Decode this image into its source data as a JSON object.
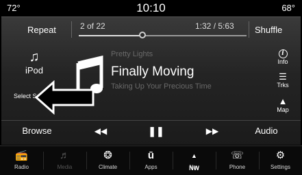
{
  "status": {
    "temp_left": "72°",
    "time": "10:10",
    "temp_right": "68°"
  },
  "controls": {
    "repeat": "Repeat",
    "track_count": "2 of 22",
    "time_readout": "1:32 / 5:63",
    "shuffle": "Shuffle",
    "progress": 0.38
  },
  "source": {
    "label": "iPod",
    "select_source": "Select Source",
    "icon": "music-note-icon"
  },
  "track": {
    "artist": "Pretty Lights",
    "title": "Finally Moving",
    "album": "Taking Up Your Precious Time"
  },
  "right_buttons": [
    {
      "label": "Info",
      "icon": "info-icon"
    },
    {
      "label": "Trks",
      "icon": "tracks-list-icon"
    },
    {
      "label": "Map",
      "icon": "map-icon"
    }
  ],
  "transport": {
    "browse": "Browse",
    "audio": "Audio",
    "rewind_icon": "rewind-icon",
    "pause_icon": "pause-icon",
    "forward_icon": "fast-forward-icon"
  },
  "nav": [
    {
      "label": "Radio",
      "icon": "radio-icon"
    },
    {
      "label": "Media",
      "icon": "media-icon"
    },
    {
      "label": "Climate",
      "icon": "climate-icon"
    },
    {
      "label": "Apps",
      "icon": "apps-icon"
    },
    {
      "label": "Nav",
      "icon": "nav-compass-icon",
      "icon_text": "NW"
    },
    {
      "label": "Phone",
      "icon": "phone-icon"
    },
    {
      "label": "Settings",
      "icon": "settings-icon"
    }
  ]
}
